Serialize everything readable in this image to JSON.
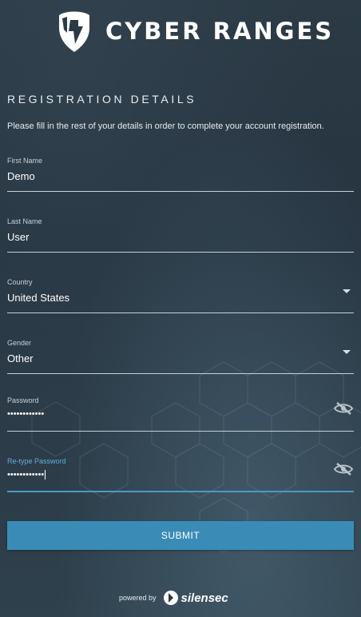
{
  "brand": {
    "name": "CYBER RANGES",
    "logo_icon": "helmet-shield-icon"
  },
  "form": {
    "title": "REGISTRATION DETAILS",
    "intro": "Please fill in the rest of your details in order to complete your account registration.",
    "first_name": {
      "label": "First Name",
      "value": "Demo"
    },
    "last_name": {
      "label": "Last Name",
      "value": "User"
    },
    "country": {
      "label": "Country",
      "value": "United States"
    },
    "gender": {
      "label": "Gender",
      "value": "Other"
    },
    "password": {
      "label": "Password",
      "value": "••••••••••••"
    },
    "retype_password": {
      "label": "Re-type Password",
      "value": "••••••••••••"
    },
    "submit_label": "SUBMIT"
  },
  "footer": {
    "powered_by": "powered by",
    "partner": "silensec"
  },
  "colors": {
    "accent": "#3a8cb7",
    "active_field": "#4a9bc6",
    "background": "#2b3a45"
  }
}
